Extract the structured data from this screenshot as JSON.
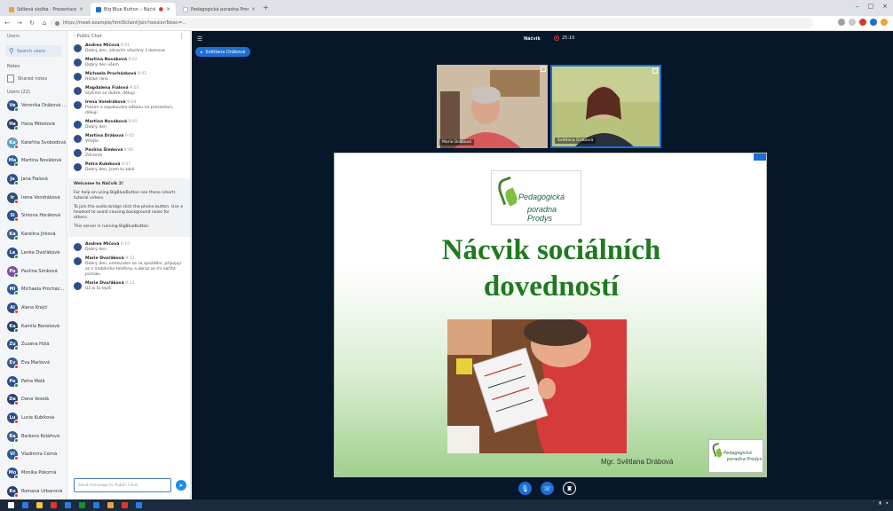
{
  "browser": {
    "tabs": [
      {
        "title": "Sdílená složka · Prezentace",
        "active": false
      },
      {
        "title": "Big Blue Button – Náčvik",
        "active": true
      },
      {
        "title": "Pedagogická poradna Prodys",
        "active": false
      }
    ],
    "url": "https://meet.example/html5client/join?sessionToken=…"
  },
  "users_panel": {
    "title": "Users",
    "search": "Search users",
    "notes_section": "Notes",
    "notes_item": "Shared notes",
    "users_section": "Users (22)",
    "users": [
      {
        "initials": "Ve",
        "name": "Veronika Drábová (You)",
        "color": "#2c4e8a",
        "muted": false
      },
      {
        "initials": "Ha",
        "name": "Hana Mikešová",
        "color": "#25406f",
        "muted": false
      },
      {
        "initials": "Ka",
        "name": "Kateřina Svobodová",
        "color": "#5a9ec9",
        "muted": true
      },
      {
        "initials": "Ma",
        "name": "Martina Nováková",
        "color": "#2a5a9a",
        "muted": false
      },
      {
        "initials": "Ja",
        "name": "Jana Fialová",
        "color": "#2c4e8a",
        "muted": false
      },
      {
        "initials": "Ir",
        "name": "Irena Vondráková",
        "color": "#314b7a",
        "muted": true
      },
      {
        "initials": "Si",
        "name": "Simona Horáková",
        "color": "#2c4e8a",
        "muted": true
      },
      {
        "initials": "Ka",
        "name": "Karolína Jirková",
        "color": "#3c5a8d",
        "muted": false
      },
      {
        "initials": "Le",
        "name": "Lenka Dvořáková",
        "color": "#2c4e8a",
        "muted": false
      },
      {
        "initials": "Pa",
        "name": "Pavlína Šimková",
        "color": "#7a4fa3",
        "muted": false
      },
      {
        "initials": "Mi",
        "name": "Michaela Procházková",
        "color": "#2a5a9a",
        "muted": false
      },
      {
        "initials": "Al",
        "name": "Alena Krejčí",
        "color": "#2c4e8a",
        "muted": true
      },
      {
        "initials": "Ka",
        "name": "Kamila Benešová",
        "color": "#25406f",
        "muted": false
      },
      {
        "initials": "Zu",
        "name": "Zuzana Holá",
        "color": "#2c4e8a",
        "muted": false
      },
      {
        "initials": "Ev",
        "name": "Eva Marková",
        "color": "#3c5a8d",
        "muted": true
      },
      {
        "initials": "Pe",
        "name": "Petra Malá",
        "color": "#2c4e8a",
        "muted": false
      },
      {
        "initials": "Da",
        "name": "Dana Veselá",
        "color": "#25406f",
        "muted": true
      },
      {
        "initials": "Lu",
        "name": "Lucie Kubíková",
        "color": "#2c4e8a",
        "muted": true
      },
      {
        "initials": "Ba",
        "name": "Barbora Kolářová",
        "color": "#3c5a8d",
        "muted": false
      },
      {
        "initials": "Vl",
        "name": "Vladimíra Černá",
        "color": "#2a5a9a",
        "muted": true
      },
      {
        "initials": "Mo",
        "name": "Monika Pokorná",
        "color": "#2c4e8a",
        "muted": false
      },
      {
        "initials": "Ro",
        "name": "Romana Urbanová",
        "color": "#25406f",
        "muted": true
      }
    ]
  },
  "chat": {
    "title": "Public Chat",
    "messages_top": [
      {
        "name": "Andrea Mičová",
        "time": "9:01",
        "text": "Dobrý den, zdravím všechny z domova"
      },
      {
        "name": "Martina Nováková",
        "time": "9:02",
        "text": "Dobrý den všem"
      },
      {
        "name": "Michaela Procházková",
        "time": "9:02",
        "text": "Hezké ráno"
      },
      {
        "name": "Magdalena Fialová",
        "time": "9:03",
        "text": "Slyšíme se dobře, děkuji"
      },
      {
        "name": "Irena Vondráková",
        "time": "9:04",
        "text": "Prosím o zopakování odkazu na prezentaci, děkuji"
      },
      {
        "name": "Martina Nováková",
        "time": "9:05",
        "text": "Dobrý den"
      },
      {
        "name": "Martina Drábová",
        "time": "9:05",
        "text": "Vítejte"
      },
      {
        "name": "Pavlína Šimková",
        "time": "9:06",
        "text": "Zdravím"
      },
      {
        "name": "Petra Kubíková",
        "time": "9:07",
        "text": "Dobrý den, jsem tu také"
      }
    ],
    "welcome": {
      "title": "Welcome to Náčvik 2!",
      "p1": "For help on using BigBlueButton see these (short) tutorial videos.",
      "p2": "To join the audio bridge click the phone button. Use a headset to avoid causing background noise for others.",
      "p3": "This server is running BigBlueButton."
    },
    "messages_bottom": [
      {
        "name": "Andrea Mičová",
        "time": "9:10",
        "text": "Dobrý den"
      },
      {
        "name": "Marie Dvořáková",
        "time": "9:11",
        "text": "Dobrý den, omlouvám se za zpoždění, připojuji se z mobilního telefonu a obraz se mi načítá pomalu"
      },
      {
        "name": "Marie Dvořáková",
        "time": "9:12",
        "text": "Už je to lepší"
      }
    ],
    "input_placeholder": "Send message to Public Chat",
    "send_icon": "send-icon"
  },
  "main": {
    "session_title": "Náčvik",
    "recording_time": "25:10",
    "presenter_label": "Světlana Drábová",
    "videos": [
      {
        "label": "Marie Drábová",
        "muted": false
      },
      {
        "label": "Světlana Drábová",
        "muted": true
      }
    ],
    "slide": {
      "logo_line1": "Pedagogická",
      "logo_line2": "poradna Prodys",
      "title_line1": "Nácvik sociálních",
      "title_line2": "dovedností",
      "author": "Mgr. Světlana Drábová",
      "title_color": "#1f7a1f"
    },
    "controls": [
      {
        "name": "audio-button",
        "icon": "microphone-icon"
      },
      {
        "name": "phone-button",
        "icon": "phone-icon"
      },
      {
        "name": "webcam-button",
        "icon": "camera-icon"
      }
    ]
  },
  "colors": {
    "accent": "#1b6fd6",
    "main_bg": "#06172a",
    "muted": "#d8392b",
    "online": "#1f8a3a"
  }
}
